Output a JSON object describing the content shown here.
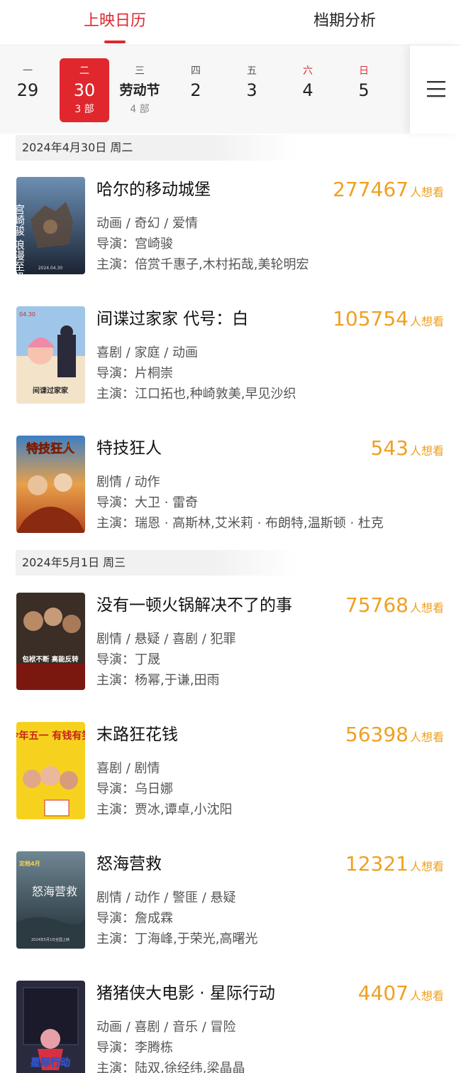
{
  "tabs": {
    "calendar": "上映日历",
    "analysis": "档期分析"
  },
  "dates": [
    {
      "weekday": "一",
      "day": "29",
      "count": ""
    },
    {
      "weekday": "二",
      "day": "30",
      "count": "3 部"
    },
    {
      "weekday": "三",
      "day": "劳动节",
      "count": "4 部"
    },
    {
      "weekday": "四",
      "day": "2",
      "count": ""
    },
    {
      "weekday": "五",
      "day": "3",
      "count": ""
    },
    {
      "weekday": "六",
      "day": "4",
      "count": ""
    },
    {
      "weekday": "日",
      "day": "5",
      "count": ""
    }
  ],
  "sections": [
    {
      "date": "2024年4月30日  周二"
    },
    {
      "date": "2024年5月1日  周三"
    }
  ],
  "wish_label": "人想看",
  "director_prefix": "导演：",
  "cast_prefix": "主演：",
  "movies": [
    {
      "title": "哈尔的移动城堡",
      "wish": "277467",
      "genre": "动画 / 奇幻 / 爱情",
      "director": "宫崎骏",
      "cast": "倍赏千惠子,木村拓哉,美轮明宏"
    },
    {
      "title": "间谍过家家 代号：白",
      "wish": "105754",
      "genre": "喜剧 / 家庭 / 动画",
      "director": "片桐崇",
      "cast": "江口拓也,种崎敦美,早见沙织"
    },
    {
      "title": "特技狂人",
      "wish": "543",
      "genre": "剧情 / 动作",
      "director": "大卫 · 雷奇",
      "cast": "瑞恩 · 高斯林,艾米莉 · 布朗特,温斯顿 · 杜克"
    },
    {
      "title": "没有一顿火锅解决不了的事",
      "wish": "75768",
      "genre": "剧情 / 悬疑 / 喜剧 / 犯罪",
      "director": "丁晟",
      "cast": "杨幂,于谦,田雨"
    },
    {
      "title": "末路狂花钱",
      "wish": "56398",
      "genre": "喜剧 / 剧情",
      "director": "乌日娜",
      "cast": "贾冰,谭卓,小沈阳"
    },
    {
      "title": "怒海营救",
      "wish": "12321",
      "genre": "剧情 / 动作 / 警匪 / 悬疑",
      "director": "詹成霖",
      "cast": "丁海峰,于荣光,高曙光"
    },
    {
      "title": "猪猪侠大电影 · 星际行动",
      "wish": "4407",
      "genre": "动画 / 喜剧 / 音乐 / 冒险",
      "director": "李腾栋",
      "cast": "陆双,徐经纬,梁晶晶"
    }
  ],
  "posters": [
    {
      "text": "宫崎骏 浪漫至极",
      "date": "2024.04.30"
    },
    {
      "text": "间谍过家家",
      "date": "04.30"
    },
    {
      "text": "特技狂人"
    },
    {
      "text": "包袱不断 高能反转"
    },
    {
      "text": "今年五一 有钱有笑"
    },
    {
      "text": "怒海营救",
      "date": "2024年5月1日全国上映",
      "top": "定档4月"
    },
    {
      "text": "星际行动"
    }
  ],
  "colors": {
    "accent": "#e0272d",
    "wish": "#f0a020",
    "weekend": "#d8323a"
  }
}
